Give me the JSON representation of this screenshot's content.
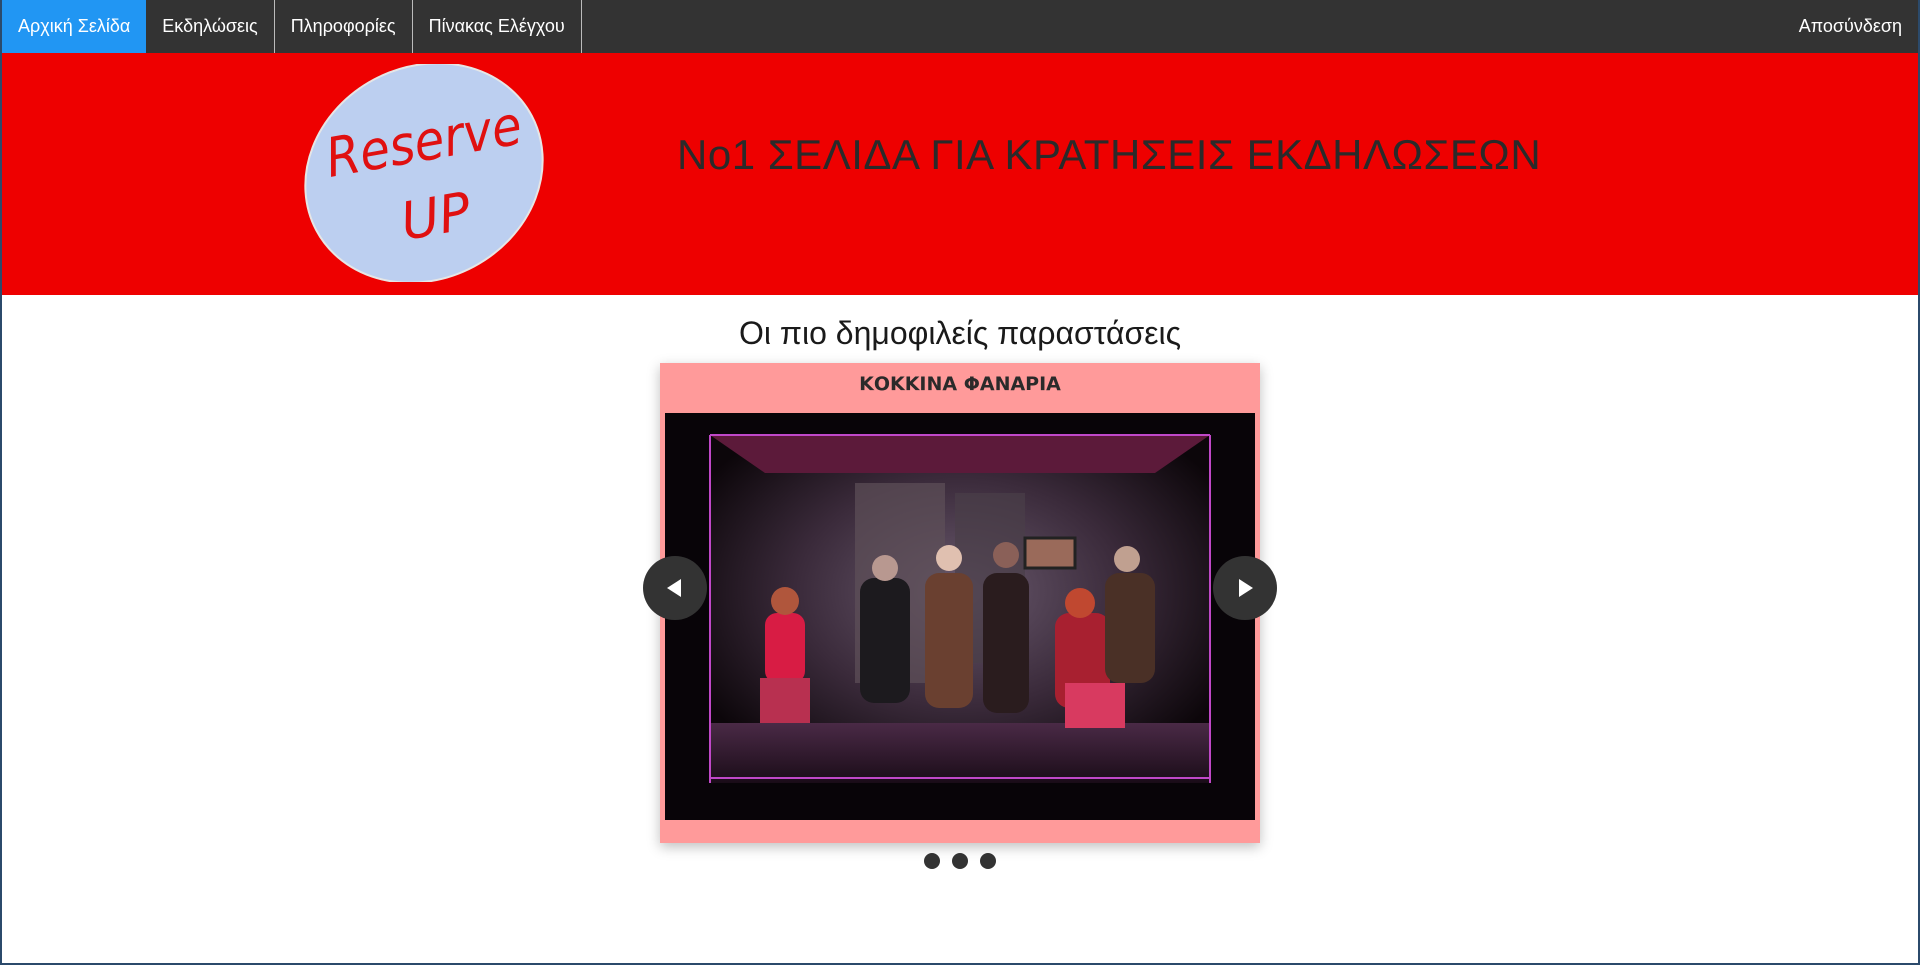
{
  "nav": {
    "items": [
      {
        "label": "Αρχική Σελίδα",
        "active": true
      },
      {
        "label": "Εκδηλώσεις",
        "active": false
      },
      {
        "label": "Πληροφορίες",
        "active": false
      },
      {
        "label": "Πίνακας Ελέγχου",
        "active": false
      }
    ],
    "logout_label": "Αποσύνδεση"
  },
  "banner": {
    "logo_text_line1": "Reserve",
    "logo_text_line2": "UP",
    "title": "Νο1 ΣΕΛΙΔΑ ΓΙΑ ΚΡΑΤΗΣΕΙΣ ΕΚΔΗΛΩΣΕΩΝ"
  },
  "main": {
    "section_title": "Οι πιο δημοφιλείς παραστάσεις",
    "carousel": {
      "current_slide_title": "ΚΟΚΚΙΝΑ ΦΑΝΑΡΙΑ",
      "slide_count": 3
    }
  },
  "colors": {
    "nav_bg": "#333333",
    "nav_active": "#2196f3",
    "banner_bg": "#ee0000",
    "logo_fill": "#bccff0",
    "card_bg": "#ff9a9a"
  }
}
